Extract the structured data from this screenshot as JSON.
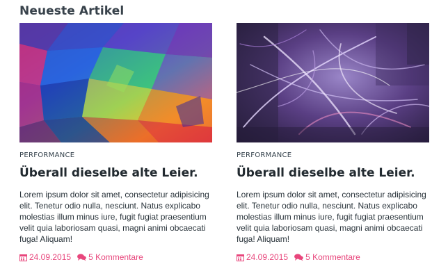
{
  "section": {
    "title": "Neueste Artikel"
  },
  "colors": {
    "accent": "#e8467c",
    "heading": "#222a30"
  },
  "articles": [
    {
      "image_icon": "abstract-polygon-image",
      "category": "PERFORMANCE",
      "title": "Überall dieselbe alte Leier.",
      "excerpt": "Lorem ipsum dolor sit amet, consectetur adipisicing elit. Tenetur odio nulla, nesciunt. Natus explicabo molestias illum minus iure, fugit fugiat praesentium velit quia laboriosam quasi, magni animi obcaecati fuga! Aliquam!",
      "date_icon": "calendar-icon",
      "date": "24.09.2015",
      "comments_icon": "comments-icon",
      "comments": "5 Kommentare"
    },
    {
      "image_icon": "abstract-light-streaks-image",
      "category": "PERFORMANCE",
      "title": "Überall dieselbe alte Leier.",
      "excerpt": "Lorem ipsum dolor sit amet, consectetur adipisicing elit. Tenetur odio nulla, nesciunt. Natus explicabo molestias illum minus iure, fugit fugiat praesentium velit quia laboriosam quasi, magni animi obcaecati fuga! Aliquam!",
      "date_icon": "calendar-icon",
      "date": "24.09.2015",
      "comments_icon": "comments-icon",
      "comments": "5 Kommentare"
    }
  ]
}
